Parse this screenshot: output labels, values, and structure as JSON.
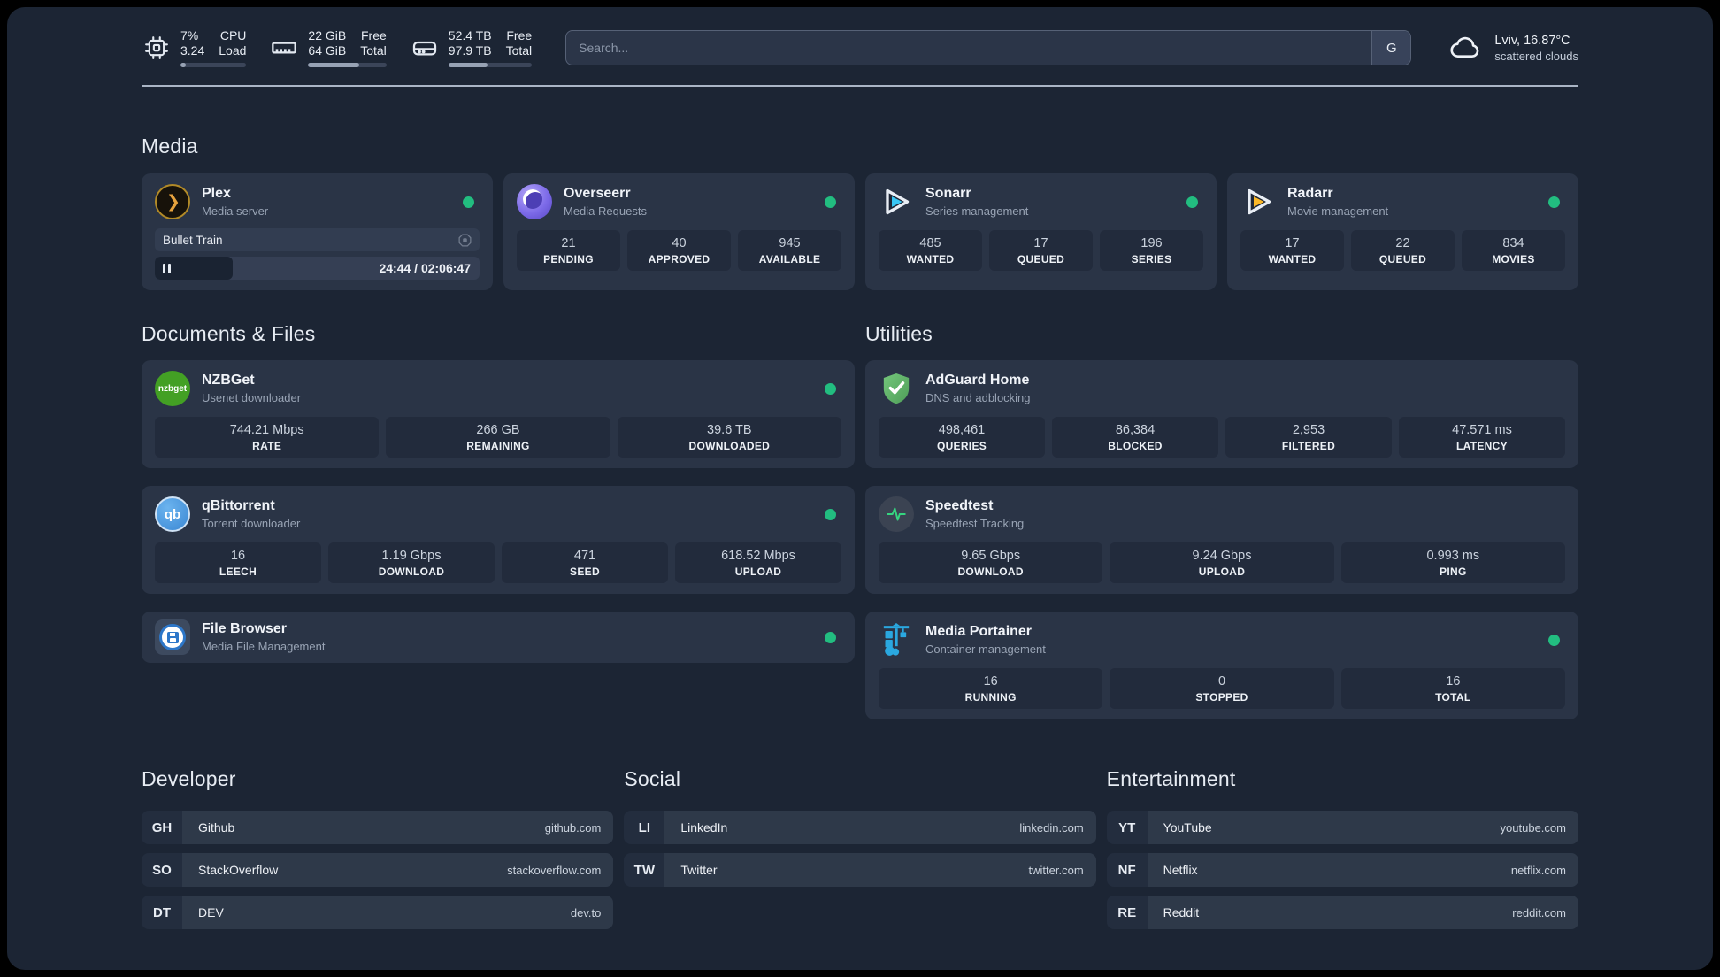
{
  "header": {
    "stats": [
      {
        "icon": "cpu-icon",
        "values": [
          "7%",
          "3.24"
        ],
        "labels": [
          "CPU",
          "Load"
        ],
        "progress_pct": 8
      },
      {
        "icon": "memory-icon",
        "values": [
          "22 GiB",
          "64 GiB"
        ],
        "labels": [
          "Free",
          "Total"
        ],
        "progress_pct": 65
      },
      {
        "icon": "storage-icon",
        "values": [
          "52.4 TB",
          "97.9 TB"
        ],
        "labels": [
          "Free",
          "Total"
        ],
        "progress_pct": 47
      }
    ],
    "search": {
      "placeholder": "Search...",
      "provider_button": "G"
    },
    "weather": {
      "icon": "cloud-icon",
      "location_temp": "Lviv, 16.87°C",
      "condition": "scattered clouds"
    }
  },
  "media": {
    "heading": "Media",
    "plex": {
      "icon": "plex-icon",
      "title": "Plex",
      "subtitle": "Media server",
      "status": "online",
      "now_playing": {
        "title": "Bullet Train",
        "time": "24:44 / 02:06:47",
        "progress_pct": 24,
        "state": "paused"
      }
    },
    "overseerr": {
      "icon": "overseerr-icon",
      "title": "Overseerr",
      "subtitle": "Media Requests",
      "status": "online",
      "stats": [
        {
          "value": "21",
          "label": "PENDING"
        },
        {
          "value": "40",
          "label": "APPROVED"
        },
        {
          "value": "945",
          "label": "AVAILABLE"
        }
      ]
    },
    "sonarr": {
      "icon": "sonarr-icon",
      "title": "Sonarr",
      "subtitle": "Series management",
      "status": "online",
      "stats": [
        {
          "value": "485",
          "label": "WANTED"
        },
        {
          "value": "17",
          "label": "QUEUED"
        },
        {
          "value": "196",
          "label": "SERIES"
        }
      ]
    },
    "radarr": {
      "icon": "radarr-icon",
      "title": "Radarr",
      "subtitle": "Movie management",
      "status": "online",
      "stats": [
        {
          "value": "17",
          "label": "WANTED"
        },
        {
          "value": "22",
          "label": "QUEUED"
        },
        {
          "value": "834",
          "label": "MOVIES"
        }
      ]
    }
  },
  "documents": {
    "heading": "Documents & Files",
    "nzbget": {
      "icon": "nzbget-icon",
      "icon_text": "nzbget",
      "title": "NZBGet",
      "subtitle": "Usenet downloader",
      "status": "online",
      "stats": [
        {
          "value": "744.21 Mbps",
          "label": "RATE"
        },
        {
          "value": "266 GB",
          "label": "REMAINING"
        },
        {
          "value": "39.6 TB",
          "label": "DOWNLOADED"
        }
      ]
    },
    "qbittorrent": {
      "icon": "qbittorrent-icon",
      "icon_text": "qb",
      "title": "qBittorrent",
      "subtitle": "Torrent downloader",
      "status": "online",
      "stats": [
        {
          "value": "16",
          "label": "LEECH"
        },
        {
          "value": "1.19 Gbps",
          "label": "DOWNLOAD"
        },
        {
          "value": "471",
          "label": "SEED"
        },
        {
          "value": "618.52 Mbps",
          "label": "UPLOAD"
        }
      ]
    },
    "filebrowser": {
      "icon": "filebrowser-icon",
      "title": "File Browser",
      "subtitle": "Media File Management",
      "status": "online"
    }
  },
  "utilities": {
    "heading": "Utilities",
    "adguard": {
      "icon": "adguard-icon",
      "title": "AdGuard Home",
      "subtitle": "DNS and adblocking",
      "stats": [
        {
          "value": "498,461",
          "label": "QUERIES"
        },
        {
          "value": "86,384",
          "label": "BLOCKED"
        },
        {
          "value": "2,953",
          "label": "FILTERED"
        },
        {
          "value": "47.571 ms",
          "label": "LATENCY"
        }
      ]
    },
    "speedtest": {
      "icon": "speedtest-icon",
      "title": "Speedtest",
      "subtitle": "Speedtest Tracking",
      "stats": [
        {
          "value": "9.65 Gbps",
          "label": "DOWNLOAD"
        },
        {
          "value": "9.24 Gbps",
          "label": "UPLOAD"
        },
        {
          "value": "0.993 ms",
          "label": "PING"
        }
      ]
    },
    "portainer": {
      "icon": "portainer-icon",
      "title": "Media Portainer",
      "subtitle": "Container management",
      "status": "online",
      "stats": [
        {
          "value": "16",
          "label": "RUNNING"
        },
        {
          "value": "0",
          "label": "STOPPED"
        },
        {
          "value": "16",
          "label": "TOTAL"
        }
      ]
    }
  },
  "links": {
    "developer": {
      "heading": "Developer",
      "items": [
        {
          "abbr": "GH",
          "name": "Github",
          "url": "github.com"
        },
        {
          "abbr": "SO",
          "name": "StackOverflow",
          "url": "stackoverflow.com"
        },
        {
          "abbr": "DT",
          "name": "DEV",
          "url": "dev.to"
        }
      ]
    },
    "social": {
      "heading": "Social",
      "items": [
        {
          "abbr": "LI",
          "name": "LinkedIn",
          "url": "linkedin.com"
        },
        {
          "abbr": "TW",
          "name": "Twitter",
          "url": "twitter.com"
        }
      ]
    },
    "entertainment": {
      "heading": "Entertainment",
      "items": [
        {
          "abbr": "YT",
          "name": "YouTube",
          "url": "youtube.com"
        },
        {
          "abbr": "NF",
          "name": "Netflix",
          "url": "netflix.com"
        },
        {
          "abbr": "RE",
          "name": "Reddit",
          "url": "reddit.com"
        }
      ]
    }
  },
  "colors": {
    "background": "#1c2534",
    "card": "#2a3446",
    "tile": "#222b3c",
    "status_online": "#22bd80",
    "plex_accent": "#e8a33d",
    "sonarr_accent": "#38c6f4",
    "radarr_accent": "#fcb827",
    "adguard_accent": "#68c16f",
    "portainer_accent": "#2aa8e0"
  }
}
